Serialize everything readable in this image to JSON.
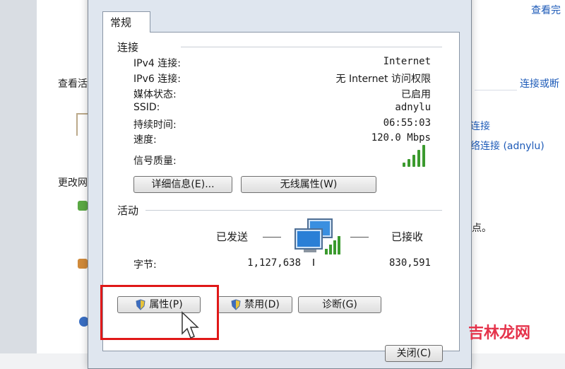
{
  "background": {
    "top_link": "查看完",
    "view_label": "查看活",
    "connect_link": "连接或断",
    "change_label": "更改网",
    "conn_link": "连接",
    "conn_link2": "络连接 (adnylu)",
    "dot_text": "点。"
  },
  "dialog": {
    "tab_label": "常规",
    "connection": {
      "title": "连接",
      "rows": [
        {
          "label": "IPv4 连接:",
          "value": "Internet"
        },
        {
          "label": "IPv6 连接:",
          "value": "无 Internet 访问权限"
        },
        {
          "label": "媒体状态:",
          "value": "已启用"
        },
        {
          "label": "SSID:",
          "value": "adnylu"
        },
        {
          "label": "持续时间:",
          "value": "06:55:03"
        },
        {
          "label": "速度:",
          "value": "120.0 Mbps"
        }
      ],
      "signal_label": "信号质量:",
      "signal_bars": 5,
      "details_button": "详细信息(E)...",
      "wireless_button": "无线属性(W)"
    },
    "activity": {
      "title": "活动",
      "sent_label": "已发送",
      "received_label": "已接收",
      "bytes_label": "字节:",
      "bytes_sent": "1,127,638",
      "bytes_received": "830,591"
    },
    "properties_button": "属性(P)",
    "disable_button": "禁用(D)",
    "diagnose_button": "诊断(G)",
    "close_button": "关闭(C)"
  },
  "watermark": {
    "part1": "吉林",
    "part2": "龙网"
  },
  "colors": {
    "highlight": "#e01818",
    "signal": "#3b9a2e",
    "link": "#1e5bb8"
  }
}
